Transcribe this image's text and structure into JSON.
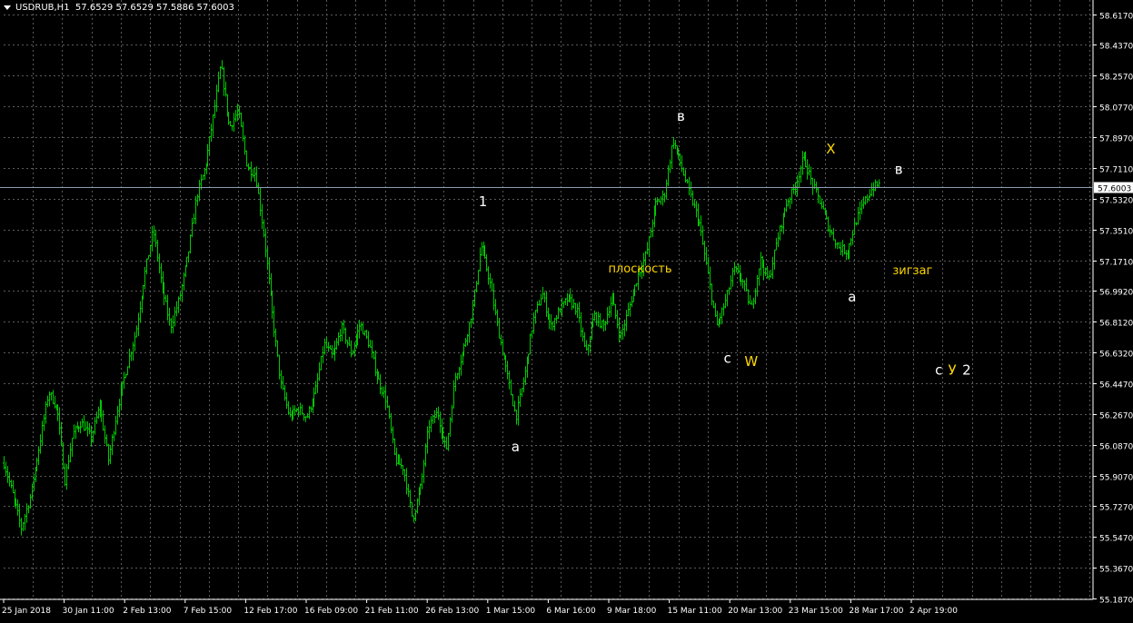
{
  "header": {
    "symbol": "USDRUB,H1",
    "ohlc": "57.6529 57.6529 57.5886 57.6003"
  },
  "colors": {
    "background": "#000000",
    "grid": "#5a5a5a",
    "candles": "#00c800",
    "axis_text": "#ffffff",
    "price_line": "#8c9bb0",
    "price_tag_bg": "#ffffff",
    "price_tag_text": "#000000",
    "white_label": "#ffffff",
    "yellow_label": "#ffd700"
  },
  "chart_data": {
    "type": "line",
    "ylim": [
      55.18,
      58.7
    ],
    "y_ticks": [
      "58.6170",
      "58.4370",
      "58.2570",
      "58.0770",
      "57.8970",
      "57.7110",
      "57.5320",
      "57.3510",
      "57.1710",
      "56.9920",
      "56.8120",
      "56.6320",
      "56.4470",
      "56.2670",
      "56.0870",
      "55.9070",
      "55.7270",
      "55.5470",
      "55.3670",
      "55.1870"
    ],
    "x_labels": [
      "25 Jan 2018",
      "30 Jan 11:00",
      "2 Feb 13:00",
      "7 Feb 15:00",
      "12 Feb 17:00",
      "16 Feb 09:00",
      "21 Feb 11:00",
      "26 Feb 13:00",
      "1 Mar 15:00",
      "6 Mar 16:00",
      "9 Mar 18:00",
      "15 Mar 11:00",
      "20 Mar 13:00",
      "23 Mar 15:00",
      "28 Mar 17:00",
      "2 Apr 19:00"
    ],
    "x_index_range": [
      0,
      100
    ],
    "current_price": "57.6003",
    "anchors": [
      [
        0,
        55.98
      ],
      [
        1,
        55.75
      ],
      [
        1.6,
        55.6
      ],
      [
        2.4,
        55.78
      ],
      [
        3.3,
        56.1
      ],
      [
        4.1,
        56.4
      ],
      [
        4.9,
        56.3
      ],
      [
        5.6,
        55.88
      ],
      [
        6.3,
        56.15
      ],
      [
        7.1,
        56.22
      ],
      [
        8,
        56.13
      ],
      [
        8.8,
        56.32
      ],
      [
        9.6,
        56.0
      ],
      [
        10.4,
        56.3
      ],
      [
        11.3,
        56.55
      ],
      [
        12.1,
        56.75
      ],
      [
        12.9,
        57.08
      ],
      [
        13.7,
        57.35
      ],
      [
        14.5,
        57.02
      ],
      [
        15.3,
        56.78
      ],
      [
        16.1,
        56.95
      ],
      [
        16.9,
        57.2
      ],
      [
        17.7,
        57.55
      ],
      [
        18.5,
        57.72
      ],
      [
        19.3,
        58.05
      ],
      [
        19.9,
        58.32
      ],
      [
        20.7,
        57.95
      ],
      [
        21.5,
        58.05
      ],
      [
        22.3,
        57.72
      ],
      [
        23.1,
        57.68
      ],
      [
        23.9,
        57.3
      ],
      [
        24.7,
        56.82
      ],
      [
        25.4,
        56.45
      ],
      [
        26.2,
        56.25
      ],
      [
        27,
        56.3
      ],
      [
        27.8,
        56.25
      ],
      [
        28.6,
        56.4
      ],
      [
        29.4,
        56.68
      ],
      [
        30.2,
        56.6
      ],
      [
        31,
        56.78
      ],
      [
        31.9,
        56.62
      ],
      [
        32.7,
        56.8
      ],
      [
        33.5,
        56.68
      ],
      [
        34.3,
        56.48
      ],
      [
        35.1,
        56.35
      ],
      [
        35.9,
        56.0
      ],
      [
        36.7,
        55.95
      ],
      [
        37.5,
        55.65
      ],
      [
        38.3,
        55.85
      ],
      [
        39,
        56.2
      ],
      [
        39.8,
        56.28
      ],
      [
        40.6,
        56.05
      ],
      [
        41.4,
        56.48
      ],
      [
        42.2,
        56.65
      ],
      [
        43,
        56.88
      ],
      [
        43.8,
        57.26
      ],
      [
        44.6,
        57.05
      ],
      [
        45.4,
        56.75
      ],
      [
        46.2,
        56.5
      ],
      [
        47,
        56.25
      ],
      [
        47.8,
        56.5
      ],
      [
        48.6,
        56.82
      ],
      [
        49.4,
        56.98
      ],
      [
        50.2,
        56.78
      ],
      [
        51,
        56.88
      ],
      [
        51.8,
        56.95
      ],
      [
        52.6,
        56.88
      ],
      [
        53.4,
        56.62
      ],
      [
        54.2,
        56.85
      ],
      [
        55,
        56.78
      ],
      [
        55.8,
        56.95
      ],
      [
        56.6,
        56.72
      ],
      [
        57.4,
        56.9
      ],
      [
        58.2,
        57.08
      ],
      [
        59,
        57.22
      ],
      [
        59.8,
        57.5
      ],
      [
        60.6,
        57.55
      ],
      [
        61.4,
        57.88
      ],
      [
        62.2,
        57.72
      ],
      [
        63,
        57.55
      ],
      [
        63.8,
        57.4
      ],
      [
        64.6,
        57.1
      ],
      [
        65.4,
        56.78
      ],
      [
        66.2,
        56.92
      ],
      [
        67,
        57.12
      ],
      [
        67.8,
        57.05
      ],
      [
        68.6,
        56.88
      ],
      [
        69.4,
        57.18
      ],
      [
        70.2,
        57.05
      ],
      [
        71,
        57.3
      ],
      [
        71.8,
        57.5
      ],
      [
        72.6,
        57.6
      ],
      [
        73.4,
        57.78
      ],
      [
        74.2,
        57.62
      ],
      [
        75,
        57.5
      ],
      [
        75.8,
        57.35
      ],
      [
        76.6,
        57.25
      ],
      [
        77.4,
        57.22
      ],
      [
        78.2,
        57.4
      ],
      [
        79,
        57.52
      ],
      [
        79.8,
        57.6
      ],
      [
        80.4,
        57.62
      ]
    ]
  },
  "annotations": [
    {
      "text": "1",
      "x": 43.6,
      "y": 57.49,
      "color": "white"
    },
    {
      "text": "a",
      "x": 46.6,
      "y": 56.05,
      "color": "white"
    },
    {
      "text": "плоскость",
      "x": 55.5,
      "y": 57.1,
      "color": "yellow"
    },
    {
      "text": "в",
      "x": 61.8,
      "y": 57.99,
      "color": "white"
    },
    {
      "text": "c",
      "x": 66.1,
      "y": 56.57,
      "color": "white"
    },
    {
      "text": "W",
      "x": 68.0,
      "y": 56.55,
      "color": "yellow"
    },
    {
      "text": "X",
      "x": 75.5,
      "y": 57.8,
      "color": "yellow"
    },
    {
      "text": "a",
      "x": 77.5,
      "y": 56.93,
      "color": "white"
    },
    {
      "text": "зигзаг",
      "x": 81.6,
      "y": 57.09,
      "color": "yellow"
    },
    {
      "text": "в",
      "x": 81.8,
      "y": 57.68,
      "color": "white"
    },
    {
      "text": "c",
      "x": 85.5,
      "y": 56.5,
      "color": "white"
    },
    {
      "text": "У",
      "x": 86.7,
      "y": 56.5,
      "color": "yellow"
    },
    {
      "text": "2",
      "x": 88.0,
      "y": 56.5,
      "color": "white"
    }
  ]
}
